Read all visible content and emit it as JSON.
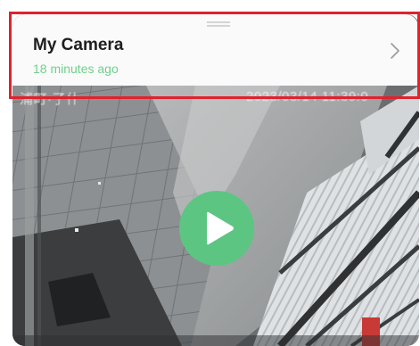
{
  "camera": {
    "name": "My Camera",
    "last_seen": "18 minutes ago"
  },
  "overlay": {
    "left_text": "浦町·了什",
    "right_text": "2023/03/14  11:39:0"
  },
  "icons": {
    "open_detail": "chevron-right-icon",
    "play": "play-icon",
    "drag": "drag-handle-icon"
  },
  "colors": {
    "accent_green": "#5cc582",
    "subtitle_green": "#6fd08a",
    "highlight_red": "#e0222e"
  }
}
